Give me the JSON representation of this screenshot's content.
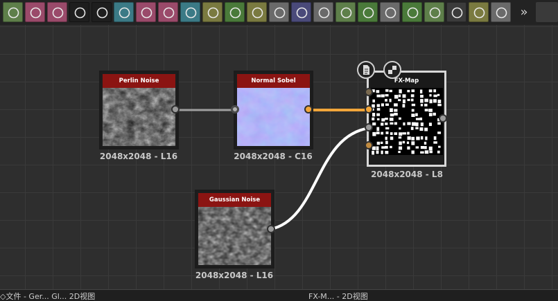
{
  "toolbar": {
    "more_label": "»",
    "tools": [
      {
        "icon": "blend-tool-icon",
        "color": "#5e7f4a"
      },
      {
        "icon": "curve-tool-icon",
        "color": "#9a4a6a"
      },
      {
        "icon": "image-input-icon",
        "color": "#9a4a6a"
      },
      {
        "icon": "value-01-icon",
        "color": "#1e1e1e"
      },
      {
        "icon": "pattern-01-icon",
        "color": "#1e1e1e"
      },
      {
        "icon": "tile-sampler-icon",
        "color": "#3b7a86"
      },
      {
        "icon": "fill-bucket-icon",
        "color": "#9a4a6a"
      },
      {
        "icon": "text-tool-icon",
        "color": "#9a4a6a"
      },
      {
        "icon": "transform-icon",
        "color": "#3b7a86"
      },
      {
        "icon": "gradient-map-icon",
        "color": "#7a7a40"
      },
      {
        "icon": "levels-icon",
        "color": "#4a7a3a"
      },
      {
        "icon": "grayscale-drop-icon",
        "color": "#7a7a40"
      },
      {
        "icon": "hsl-wheel-icon",
        "color": "#6a6a6a"
      },
      {
        "icon": "uniform-color-icon",
        "color": "#4a4a7a"
      },
      {
        "icon": "warp-icon",
        "color": "#6a6a6a"
      },
      {
        "icon": "graph-output-icon",
        "color": "#5e7f4a"
      },
      {
        "icon": "output-node-icon",
        "color": "#4a7a3a"
      },
      {
        "icon": "link-node-icon",
        "color": "#6a6a6a"
      },
      {
        "icon": "histogram-icon",
        "color": "#4a7a3a"
      },
      {
        "icon": "gradient-tool-icon",
        "color": "#5e7f4a"
      },
      {
        "icon": "shuffle-icon",
        "color": "#3b3b3b"
      },
      {
        "icon": "split-channels-icon",
        "color": "#7a7a40"
      },
      {
        "icon": "waveform-icon",
        "color": "#6a6a6a"
      }
    ]
  },
  "nodes": {
    "perlin": {
      "title": "Perlin Noise",
      "caption": "2048x2048 - L16"
    },
    "sobel": {
      "title": "Normal Sobel",
      "caption": "2048x2048 - C16"
    },
    "fxmap": {
      "title": "FX-Map",
      "caption": "2048x2048 - L8"
    },
    "gaussian": {
      "title": "Gaussian Noise",
      "caption": "2048x2048 - L16"
    }
  },
  "colors": {
    "header_red": "#8b1412",
    "link_orange": "#f2a63a",
    "link_gray": "#a0a0a0",
    "link_white": "#ffffff",
    "normal_map": "#7f7ff0"
  },
  "status": {
    "left": "◇文件 - Ger... Gl... 2D视图",
    "right": "FX-M... - 2D视图"
  }
}
